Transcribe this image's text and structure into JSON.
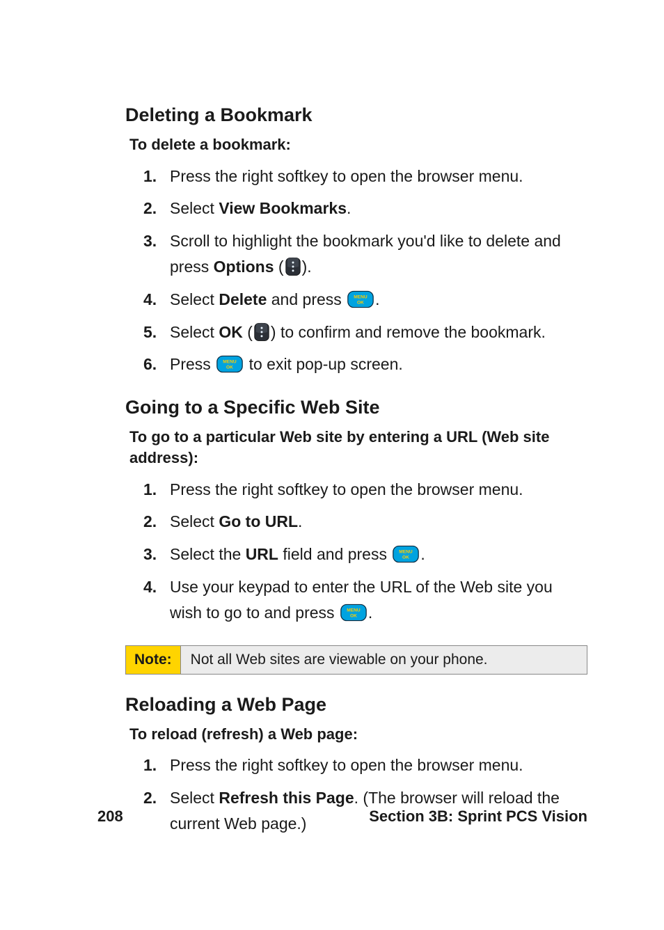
{
  "sections": {
    "deleting": {
      "heading": "Deleting a Bookmark",
      "lead": "To delete a bookmark:",
      "steps": {
        "s1": "Press the right softkey to open the browser menu.",
        "s2_a": "Select ",
        "s2_kw": "View Bookmarks",
        "s2_b": ".",
        "s3_a": "Scroll to highlight the bookmark you'd like to delete and press ",
        "s3_kw": "Options",
        "s3_b": " (",
        "s3_c": ").",
        "s4_a": "Select ",
        "s4_kw": "Delete",
        "s4_b": " and press ",
        "s4_c": ".",
        "s5_a": "Select ",
        "s5_kw": "OK",
        "s5_b": " (",
        "s5_c": ") to confirm and remove the bookmark.",
        "s6_a": "Press ",
        "s6_b": " to exit pop-up screen."
      }
    },
    "going": {
      "heading": "Going to a Specific Web Site",
      "lead": "To go to a particular Web site by entering a URL (Web site address):",
      "steps": {
        "s1": "Press the right softkey to open the browser menu.",
        "s2_a": "Select ",
        "s2_kw": "Go to URL",
        "s2_b": ".",
        "s3_a": "Select the ",
        "s3_kw": "URL",
        "s3_b": " field and press ",
        "s3_c": ".",
        "s4_a": "Use your keypad to enter the URL of the Web site you wish to go to and press ",
        "s4_b": "."
      }
    },
    "reloading": {
      "heading": "Reloading a Web Page",
      "lead": "To reload (refresh) a Web page:",
      "steps": {
        "s1": "Press the right softkey to open the browser menu.",
        "s2_a": "Select ",
        "s2_kw": "Refresh this Page",
        "s2_b": ". (The browser will reload the current Web page.)"
      }
    }
  },
  "note": {
    "label": "Note:",
    "body": "Not all Web sites are viewable on your phone."
  },
  "footer": {
    "page": "208",
    "section": "Section 3B: Sprint PCS Vision"
  },
  "icons": {
    "options_key": "options-key-icon",
    "menu_ok_key": "menu-ok-key-icon"
  },
  "colors": {
    "note_bg": "#ffd400",
    "menu_ok_fill": "#00a3e0",
    "key_fill": "#2b2f36"
  }
}
